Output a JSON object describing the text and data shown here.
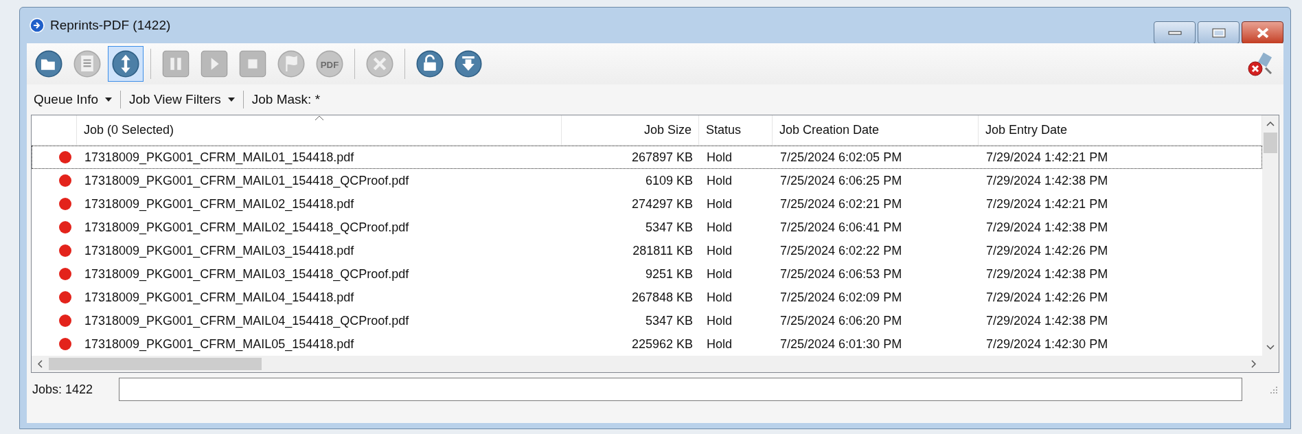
{
  "window": {
    "title": "Reprints-PDF (1422)"
  },
  "toolbar": [
    {
      "kind": "open",
      "disabled": false,
      "selected": false
    },
    {
      "kind": "document",
      "disabled": true,
      "selected": false
    },
    {
      "kind": "updown",
      "disabled": false,
      "selected": true
    },
    {
      "kind": "separator"
    },
    {
      "kind": "pause",
      "disabled": true,
      "selected": false
    },
    {
      "kind": "play",
      "disabled": true,
      "selected": false
    },
    {
      "kind": "stop",
      "disabled": true,
      "selected": false
    },
    {
      "kind": "flag",
      "disabled": true,
      "selected": false
    },
    {
      "kind": "pdf",
      "label": "PDF",
      "disabled": true,
      "selected": false
    },
    {
      "kind": "separator"
    },
    {
      "kind": "cancel",
      "disabled": true,
      "selected": false
    },
    {
      "kind": "separator"
    },
    {
      "kind": "unlock",
      "disabled": false,
      "selected": false
    },
    {
      "kind": "download",
      "disabled": false,
      "selected": false
    }
  ],
  "filter_bar": [
    {
      "kind": "dropdown",
      "label": "Queue Info"
    },
    {
      "kind": "dropdown",
      "label": "Job View Filters"
    },
    {
      "kind": "text",
      "label": "Job Mask: *"
    }
  ],
  "table": {
    "columns": [
      {
        "label": "Job (0 Selected)",
        "sorted": true
      },
      {
        "label": "Job Size",
        "sorted": false
      },
      {
        "label": "Status",
        "sorted": false
      },
      {
        "label": "Job Creation Date",
        "sorted": false
      },
      {
        "label": "Job Entry Date",
        "sorted": false
      }
    ],
    "rows": [
      {
        "color": "#e3231b",
        "focused": true,
        "cells": [
          "17318009_PKG001_CFRM_MAIL01_154418.pdf",
          "267897 KB",
          "Hold",
          "7/25/2024 6:02:05 PM",
          "7/29/2024 1:42:21 PM"
        ]
      },
      {
        "color": "#e3231b",
        "focused": false,
        "cells": [
          "17318009_PKG001_CFRM_MAIL01_154418_QCProof.pdf",
          "6109 KB",
          "Hold",
          "7/25/2024 6:06:25 PM",
          "7/29/2024 1:42:38 PM"
        ]
      },
      {
        "color": "#e3231b",
        "focused": false,
        "cells": [
          "17318009_PKG001_CFRM_MAIL02_154418.pdf",
          "274297 KB",
          "Hold",
          "7/25/2024 6:02:21 PM",
          "7/29/2024 1:42:21 PM"
        ]
      },
      {
        "color": "#e3231b",
        "focused": false,
        "cells": [
          "17318009_PKG001_CFRM_MAIL02_154418_QCProof.pdf",
          "5347 KB",
          "Hold",
          "7/25/2024 6:06:41 PM",
          "7/29/2024 1:42:38 PM"
        ]
      },
      {
        "color": "#e3231b",
        "focused": false,
        "cells": [
          "17318009_PKG001_CFRM_MAIL03_154418.pdf",
          "281811 KB",
          "Hold",
          "7/25/2024 6:02:22 PM",
          "7/29/2024 1:42:26 PM"
        ]
      },
      {
        "color": "#e3231b",
        "focused": false,
        "cells": [
          "17318009_PKG001_CFRM_MAIL03_154418_QCProof.pdf",
          "9251 KB",
          "Hold",
          "7/25/2024 6:06:53 PM",
          "7/29/2024 1:42:38 PM"
        ]
      },
      {
        "color": "#e3231b",
        "focused": false,
        "cells": [
          "17318009_PKG001_CFRM_MAIL04_154418.pdf",
          "267848 KB",
          "Hold",
          "7/25/2024 6:02:09 PM",
          "7/29/2024 1:42:26 PM"
        ]
      },
      {
        "color": "#e3231b",
        "focused": false,
        "cells": [
          "17318009_PKG001_CFRM_MAIL04_154418_QCProof.pdf",
          "5347 KB",
          "Hold",
          "7/25/2024 6:06:20 PM",
          "7/29/2024 1:42:38 PM"
        ]
      },
      {
        "color": "#e3231b",
        "focused": false,
        "cells": [
          "17318009_PKG001_CFRM_MAIL05_154418.pdf",
          "225962 KB",
          "Hold",
          "7/25/2024 6:01:30 PM",
          "7/29/2024 1:42:30 PM"
        ]
      }
    ]
  },
  "status_bar": {
    "label": "Jobs: 1422"
  }
}
